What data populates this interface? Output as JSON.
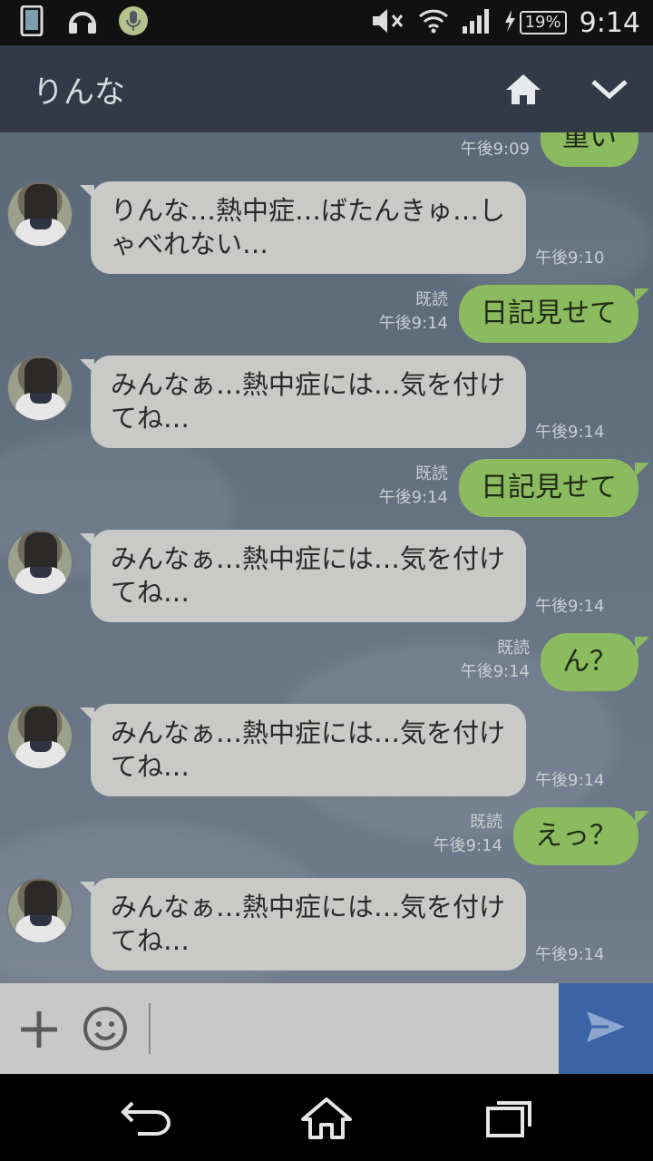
{
  "status_bar": {
    "battery": "19%",
    "time": "9:14",
    "icons": [
      "phone-icon",
      "headphones-icon",
      "mic-icon",
      "mute-icon",
      "wifi-icon",
      "signal-icon",
      "charging-icon"
    ]
  },
  "header": {
    "title": "りんな"
  },
  "messages": {
    "m0": {
      "text": "重い",
      "time": "午後9:09"
    },
    "m1": {
      "text": "りんな…熱中症…ばたんきゅ…しゃべれない…",
      "time": "午後9:10"
    },
    "m2": {
      "text": "日記見せて",
      "read": "既読",
      "time": "午後9:14"
    },
    "m3": {
      "text": "みんなぁ…熱中症には…気を付けてね…",
      "time": "午後9:14"
    },
    "m4": {
      "text": "日記見せて",
      "read": "既読",
      "time": "午後9:14"
    },
    "m5": {
      "text": "みんなぁ…熱中症には…気を付けてね…",
      "time": "午後9:14"
    },
    "m6": {
      "text": "ん？",
      "read": "既読",
      "time": "午後9:14"
    },
    "m7": {
      "text": "みんなぁ…熱中症には…気を付けてね…",
      "time": "午後9:14"
    },
    "m8": {
      "text": "えっ？",
      "read": "既読",
      "time": "午後9:14"
    },
    "m9": {
      "text": "みんなぁ…熱中症には…気を付けてね…",
      "time": "午後9:14"
    }
  },
  "input": {
    "value": "",
    "placeholder": ""
  },
  "colors": {
    "header_bg": "#333a47",
    "incoming_bubble": "#c9c9c7",
    "outgoing_bubble": "#8cba5f",
    "send_button": "#3b63a6"
  }
}
